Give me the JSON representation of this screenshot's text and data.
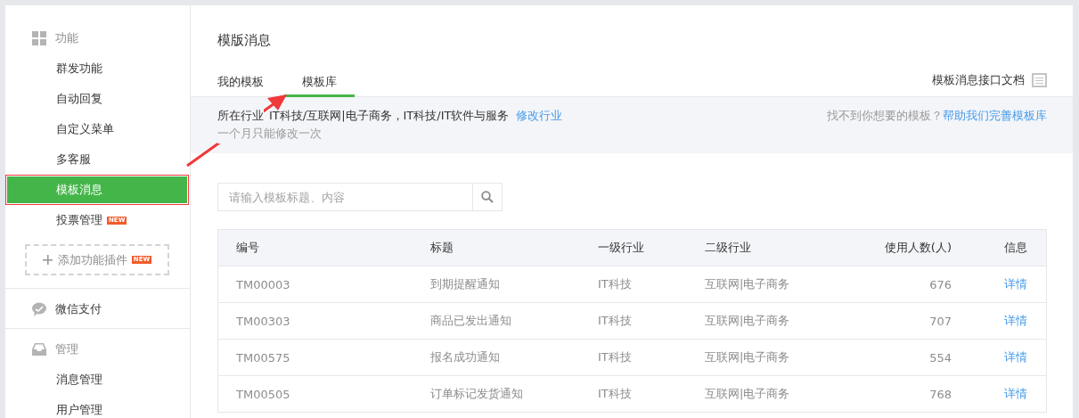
{
  "sidebar": {
    "sections": [
      {
        "title": "功能",
        "items": [
          {
            "label": "群发功能",
            "selected": false
          },
          {
            "label": "自动回复",
            "selected": false
          },
          {
            "label": "自定义菜单",
            "selected": false
          },
          {
            "label": "多客服",
            "selected": false
          },
          {
            "label": "模板消息",
            "selected": true
          },
          {
            "label": "投票管理",
            "selected": false,
            "badge": "NEW"
          }
        ],
        "add_button": {
          "label": "添加功能插件",
          "badge": "NEW"
        }
      },
      {
        "title": "微信支付"
      },
      {
        "title": "管理",
        "items": [
          {
            "label": "消息管理",
            "selected": false
          },
          {
            "label": "用户管理",
            "selected": false
          }
        ]
      }
    ]
  },
  "page_title": "模版消息",
  "tabs": [
    {
      "label": "我的模板",
      "selected": false
    },
    {
      "label": "模板库",
      "selected": true
    }
  ],
  "doc_link": "模板消息接口文档",
  "industry": {
    "label": "所在行业",
    "value": "IT科技/互联网|电子商务，IT科技/IT软件与服务",
    "edit_link": "修改行业",
    "note": "一个月只能修改一次",
    "help_text": "找不到你想要的模板？",
    "help_link": "帮助我们完善模板库"
  },
  "search": {
    "placeholder": "请输入模板标题、内容"
  },
  "table": {
    "columns": [
      "编号",
      "标题",
      "一级行业",
      "二级行业",
      "使用人数(人)",
      "信息"
    ],
    "rows": [
      [
        "TM00003",
        "到期提醒通知",
        "IT科技",
        "互联网|电子商务",
        "676",
        "详情"
      ],
      [
        "TM00303",
        "商品已发出通知",
        "IT科技",
        "互联网|电子商务",
        "707",
        "详情"
      ],
      [
        "TM00575",
        "报名成功通知",
        "IT科技",
        "互联网|电子商务",
        "554",
        "详情"
      ],
      [
        "TM00505",
        "订单标记发货通知",
        "IT科技",
        "互联网|电子商务",
        "768",
        "详情"
      ]
    ]
  }
}
